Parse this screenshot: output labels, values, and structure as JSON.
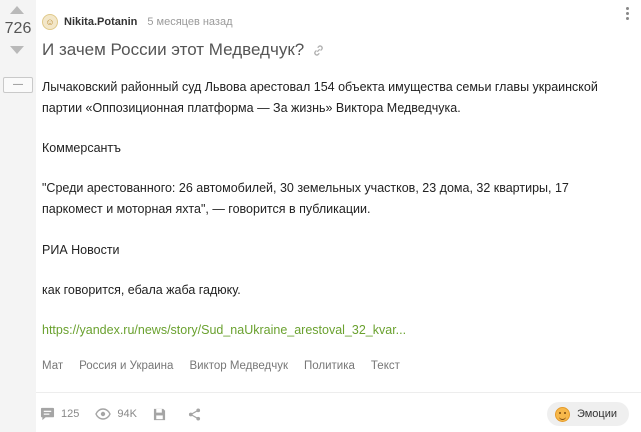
{
  "rating": {
    "value": "726",
    "collapse_label": "—"
  },
  "post": {
    "author": "Nikita.Potanin",
    "time": "5 месяцев назад",
    "title": "И зачем России этот Медведчук?",
    "paragraphs": [
      "Лычаковский районный суд Львова арестовал 154 объекта имущества семьи главы украинской партии «Оппозиционная платформа — За жизнь» Виктора Медведчука.",
      "Коммерсантъ",
      "\"Среди арестованного: 26 автомобилей, 30 земельных участков, 23 дома, 32 квартиры, 17 паркомест и моторная яхта\", — говорится в публикации.",
      "РИА Новости",
      "как говорится, ебала жаба гадюку."
    ],
    "link": "https://yandex.ru/news/story/Sud_naUkraine_arestoval_32_kvar...",
    "tags": [
      "Мат",
      "Россия и Украина",
      "Виктор Медведчук",
      "Политика",
      "Текст"
    ]
  },
  "footer": {
    "comments": "125",
    "views": "94K",
    "emotions_label": "Эмоции"
  },
  "colors": {
    "link": "#6aa12f",
    "sidebar": "#f4f4f4"
  }
}
